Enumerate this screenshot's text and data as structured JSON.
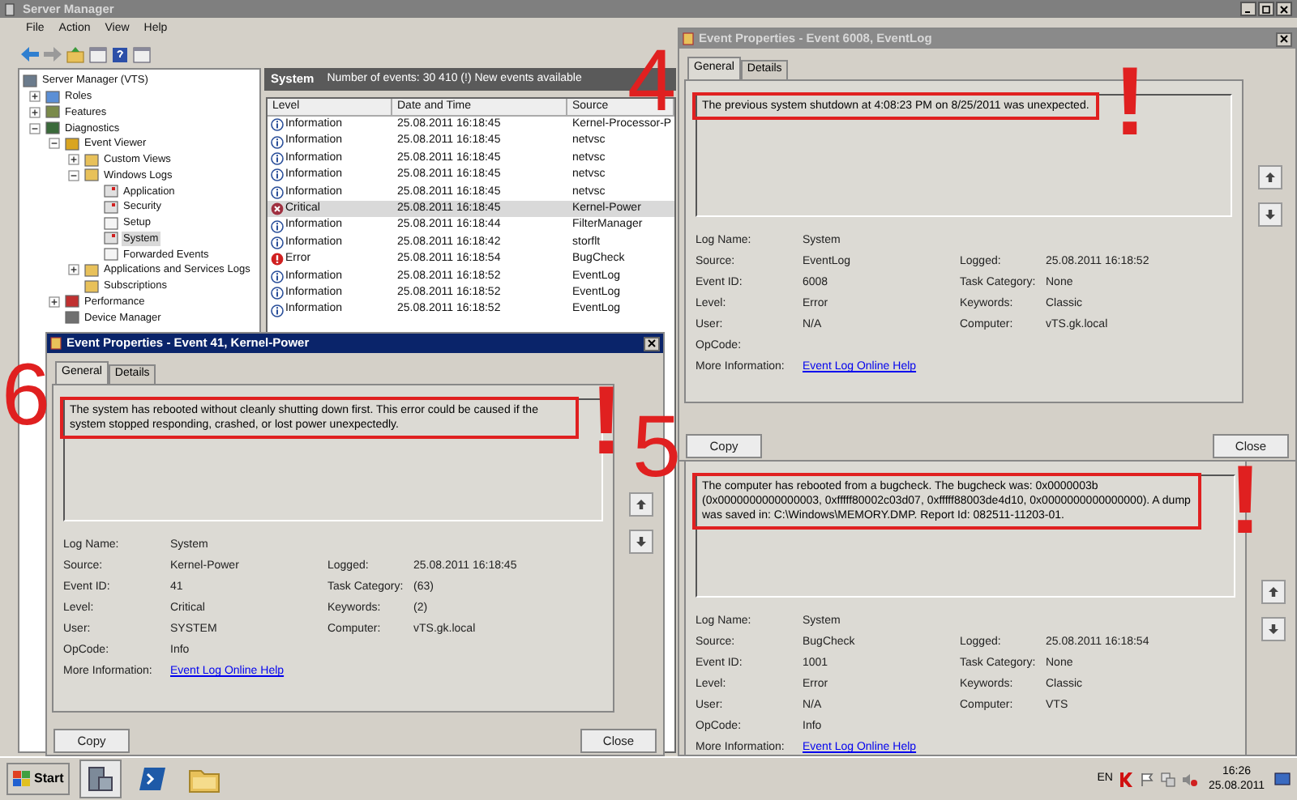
{
  "server_manager": {
    "title": "Server Manager",
    "menu": [
      "File",
      "Action",
      "View",
      "Help"
    ],
    "tree": [
      {
        "label": "Server Manager (VTS)",
        "kind": "server",
        "selected": false,
        "children": [
          {
            "label": "Roles",
            "kind": "roles",
            "expanded": false,
            "selected": false
          },
          {
            "label": "Features",
            "kind": "features",
            "expanded": false,
            "selected": false
          },
          {
            "label": "Diagnostics",
            "kind": "diagnostics",
            "expanded": true,
            "selected": false,
            "children": [
              {
                "label": "Event Viewer",
                "kind": "viewer",
                "expanded": true,
                "selected": false,
                "children": [
                  {
                    "label": "Custom Views",
                    "kind": "folder",
                    "expanded": false,
                    "selected": false
                  },
                  {
                    "label": "Windows Logs",
                    "kind": "folder",
                    "expanded": true,
                    "selected": false,
                    "children": [
                      {
                        "label": "Application",
                        "kind": "log",
                        "selected": false
                      },
                      {
                        "label": "Security",
                        "kind": "log",
                        "selected": false
                      },
                      {
                        "label": "Setup",
                        "kind": "plainlog",
                        "selected": false
                      },
                      {
                        "label": "System",
                        "kind": "log",
                        "selected": true
                      },
                      {
                        "label": "Forwarded Events",
                        "kind": "plainlog",
                        "selected": false
                      }
                    ]
                  },
                  {
                    "label": "Applications and Services Logs",
                    "kind": "folder",
                    "expanded": false,
                    "selected": false
                  },
                  {
                    "label": "Subscriptions",
                    "kind": "folder",
                    "selected": false
                  }
                ]
              },
              {
                "label": "Performance",
                "kind": "performance",
                "expanded": false,
                "selected": false
              },
              {
                "label": "Device Manager",
                "kind": "device",
                "selected": false
              }
            ]
          }
        ]
      }
    ],
    "log_header": {
      "title": "System",
      "summary": "Number of events: 30 410 (!) New events available"
    },
    "table": {
      "columns": [
        "Level",
        "Date and Time",
        "Source"
      ],
      "rows": [
        {
          "kind": "information",
          "level": "Information",
          "date": "25.08.2011 16:18:45",
          "source": "Kernel-Processor-P",
          "selected": false
        },
        {
          "kind": "information",
          "level": "Information",
          "date": "25.08.2011 16:18:45",
          "source": "netvsc",
          "selected": false
        },
        {
          "kind": "information",
          "level": "Information",
          "date": "25.08.2011 16:18:45",
          "source": "netvsc",
          "selected": false
        },
        {
          "kind": "information",
          "level": "Information",
          "date": "25.08.2011 16:18:45",
          "source": "netvsc",
          "selected": false
        },
        {
          "kind": "information",
          "level": "Information",
          "date": "25.08.2011 16:18:45",
          "source": "netvsc",
          "selected": false
        },
        {
          "kind": "critical",
          "level": "Critical",
          "date": "25.08.2011 16:18:45",
          "source": "Kernel-Power",
          "selected": true
        },
        {
          "kind": "information",
          "level": "Information",
          "date": "25.08.2011 16:18:44",
          "source": "FilterManager",
          "selected": false
        },
        {
          "kind": "information",
          "level": "Information",
          "date": "25.08.2011 16:18:42",
          "source": "storflt",
          "selected": false
        },
        {
          "kind": "error",
          "level": "Error",
          "date": "25.08.2011 16:18:54",
          "source": "BugCheck",
          "selected": false
        },
        {
          "kind": "information",
          "level": "Information",
          "date": "25.08.2011 16:18:52",
          "source": "EventLog",
          "selected": false
        },
        {
          "kind": "information",
          "level": "Information",
          "date": "25.08.2011 16:18:52",
          "source": "EventLog",
          "selected": false
        },
        {
          "kind": "information",
          "level": "Information",
          "date": "25.08.2011 16:18:52",
          "source": "EventLog",
          "selected": false
        }
      ]
    }
  },
  "dialogs": [
    {
      "title": "Event Properties - Event 6008, EventLog",
      "active": false,
      "tabs": [
        {
          "label": "General",
          "selected": true
        },
        {
          "label": "Details",
          "selected": false
        }
      ],
      "message": "The previous system shutdown at 4:08:23 PM on 8/25/2011 was unexpected.",
      "annotation": {
        "number": "4",
        "mark": "!"
      },
      "fields": [
        {
          "label": "Log Name:",
          "value": "System"
        },
        {
          "label": "Source:",
          "value": "EventLog",
          "label2": "Logged:",
          "value2": "25.08.2011 16:18:52"
        },
        {
          "label": "Event ID:",
          "value": "6008",
          "label2": "Task Category:",
          "value2": "None"
        },
        {
          "label": "Level:",
          "value": "Error",
          "label2": "Keywords:",
          "value2": "Classic"
        },
        {
          "label": "User:",
          "value": "N/A",
          "label2": "Computer:",
          "value2": "vTS.gk.local"
        },
        {
          "label": "OpCode:"
        }
      ],
      "more_info": {
        "label": "More Information:",
        "link": "Event Log Online Help"
      },
      "buttons": [
        "Copy",
        "Close"
      ]
    },
    {
      "title": "Event Properties - Event 41, Kernel-Power",
      "active": true,
      "tabs": [
        {
          "label": "General",
          "selected": true
        },
        {
          "label": "Details",
          "selected": false
        }
      ],
      "message": "The system has rebooted without cleanly shutting down first. This error could be caused if the system stopped responding, crashed, or lost power unexpectedly.",
      "annotation": {
        "number": "6",
        "mark": "!"
      },
      "fields": [
        {
          "label": "Log Name:",
          "value": "System"
        },
        {
          "label": "Source:",
          "value": "Kernel-Power",
          "label2": "Logged:",
          "value2": "25.08.2011 16:18:45"
        },
        {
          "label": "Event ID:",
          "value": "41",
          "label2": "Task Category:",
          "value2": "(63)"
        },
        {
          "label": "Level:",
          "value": "Critical",
          "label2": "Keywords:",
          "value2": "(2)"
        },
        {
          "label": "User:",
          "value": "SYSTEM",
          "label2": "Computer:",
          "value2": "vTS.gk.local"
        },
        {
          "label": "OpCode:",
          "value": "Info"
        }
      ],
      "more_info": {
        "label": "More Information:",
        "link": "Event Log Online Help"
      },
      "buttons": [
        "Copy",
        "Close"
      ]
    },
    {
      "message": "The computer has rebooted from a bugcheck.  The bugcheck was: 0x0000003b (0x0000000000000003, 0xfffff80002c03d07, 0xfffff88003de4d10, 0x0000000000000000). A dump was saved in: C:\\Windows\\MEMORY.DMP. Report Id: 082511-11203-01.",
      "annotation": {
        "number": "5",
        "mark": "!"
      },
      "fields": [
        {
          "label": "Log Name:",
          "value": "System"
        },
        {
          "label": "Source:",
          "value": "BugCheck",
          "label2": "Logged:",
          "value2": "25.08.2011 16:18:54"
        },
        {
          "label": "Event ID:",
          "value": "1001",
          "label2": "Task Category:",
          "value2": "None"
        },
        {
          "label": "Level:",
          "value": "Error",
          "label2": "Keywords:",
          "value2": "Classic"
        },
        {
          "label": "User:",
          "value": "N/A",
          "label2": "Computer:",
          "value2": "VTS"
        },
        {
          "label": "OpCode:",
          "value": "Info"
        }
      ],
      "more_info": {
        "label": "More Information:",
        "link": "Event Log Online Help"
      }
    }
  ],
  "taskbar": {
    "start": "Start",
    "apps": [
      {
        "kind": "server",
        "selected": true
      },
      {
        "kind": "powershell",
        "selected": false
      },
      {
        "kind": "explorer",
        "selected": false
      }
    ],
    "language": "EN",
    "time": "16:26",
    "date": "25.08.2011"
  }
}
